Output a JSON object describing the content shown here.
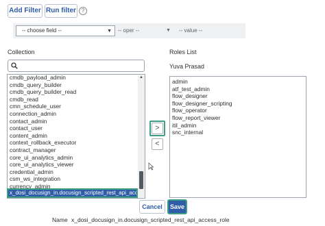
{
  "toolbar": {
    "add_filter_label": "Add Filter",
    "run_filter_label": "Run filter",
    "help_glyph": "?"
  },
  "filter": {
    "field_value": "-- choose field --",
    "oper_value": "-- oper --",
    "value_value": "-- value --"
  },
  "collection": {
    "heading": "Collection",
    "search_value": "",
    "items": [
      "cmdb_payload_admin",
      "cmdb_query_builder",
      "cmdb_query_builder_read",
      "cmdb_read",
      "cmn_schedule_user",
      "connection_admin",
      "contact_admin",
      "contact_user",
      "content_admin",
      "context_rollback_executor",
      "contract_manager",
      "core_ui_analytics_admin",
      "core_ui_analytics_viewer",
      "credential_admin",
      "csm_ws_integration",
      "currency_admin"
    ],
    "selected_item": "x_dosi_docusign_in.docusign_scripted_rest_api_access_role"
  },
  "roles": {
    "heading": "Roles List",
    "user_name": "Yuva Prasad",
    "items": [
      "admin",
      "atf_test_admin",
      "flow_designer",
      "flow_designer_scripting",
      "flow_operator",
      "flow_report_viewer",
      "itil_admin",
      "snc_internal"
    ]
  },
  "transfer": {
    "add_glyph": ">",
    "remove_glyph": "<"
  },
  "actions": {
    "cancel_label": "Cancel",
    "save_label": "Save"
  },
  "footer": {
    "name_label": "Name",
    "name_value": "x_dosi_docusign_in.docusign_scripted_rest_api_access_role"
  },
  "colors": {
    "accent": "#2f5da8",
    "focus_ring": "#3d9e83"
  }
}
